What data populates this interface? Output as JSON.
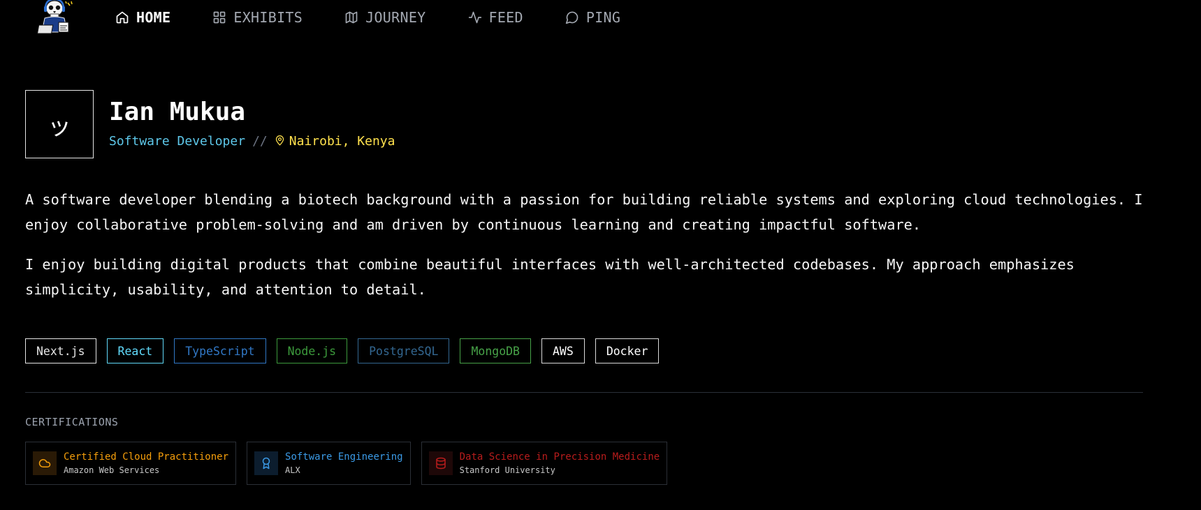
{
  "nav": {
    "items": [
      {
        "label": "HOME",
        "icon": "home-icon",
        "active": true
      },
      {
        "label": "EXHIBITS",
        "icon": "grid-icon",
        "active": false
      },
      {
        "label": "JOURNEY",
        "icon": "map-icon",
        "active": false
      },
      {
        "label": "FEED",
        "icon": "activity-icon",
        "active": false
      },
      {
        "label": "PING",
        "icon": "chat-bubble-icon",
        "active": false
      }
    ]
  },
  "profile": {
    "avatar_glyph": "ッ",
    "name": "Ian Mukua",
    "role": "Software Developer",
    "separator": "//",
    "location": "Nairobi, Kenya"
  },
  "bio": {
    "p1": "A software developer blending a biotech background with a passion for building reliable systems and exploring cloud technologies. I enjoy collaborative problem-solving and am driven by continuous learning and creating impactful software.",
    "p2": "I enjoy building digital products that combine beautiful interfaces with well-architected codebases. My approach emphasizes simplicity, usability, and attention to detail."
  },
  "tags": [
    {
      "label": "Next.js",
      "color": "#e5e5e5",
      "border": "#e5e5e5"
    },
    {
      "label": "React",
      "color": "#61dafb",
      "border": "#61dafb"
    },
    {
      "label": "TypeScript",
      "color": "#3178c6",
      "border": "#3178c6"
    },
    {
      "label": "Node.js",
      "color": "#3c9a3c",
      "border": "#3c9a3c"
    },
    {
      "label": "PostgreSQL",
      "color": "#336791",
      "border": "#336791"
    },
    {
      "label": "MongoDB",
      "color": "#47a248",
      "border": "#47a248"
    },
    {
      "label": "AWS",
      "color": "#ffffff",
      "border": "#d9d9d9"
    },
    {
      "label": "Docker",
      "color": "#ffffff",
      "border": "#d9d9d9"
    }
  ],
  "certifications": {
    "heading": "CERTIFICATIONS",
    "items": [
      {
        "title": "Certified Cloud Practitioner",
        "org": "Amazon Web Services",
        "icon": "cloud-icon",
        "color": "#f59e0b",
        "icon_bg": "#2a1a06"
      },
      {
        "title": "Software Engineering",
        "org": "ALX",
        "icon": "award-icon",
        "color": "#3b9ae6",
        "icon_bg": "#0c1d2e"
      },
      {
        "title": "Data Science in Precision Medicine",
        "org": "Stanford University",
        "icon": "database-icon",
        "color": "#b91c1c",
        "icon_bg": "#1e0808"
      }
    ]
  }
}
